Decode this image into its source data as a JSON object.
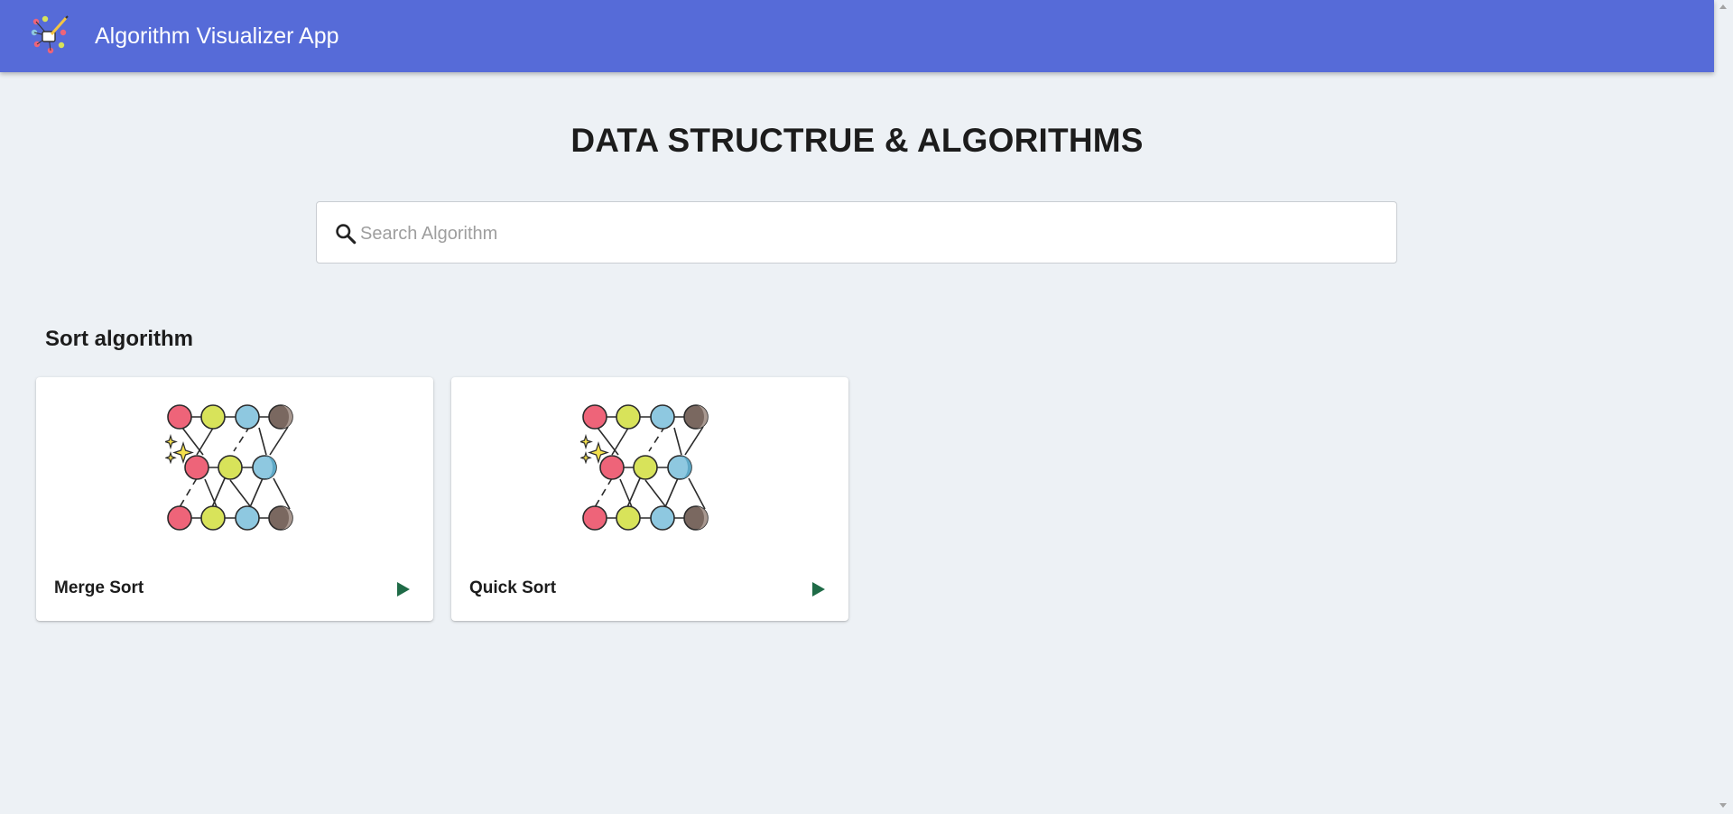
{
  "header": {
    "app_title": "Algorithm Visualizer App",
    "logo_icon": "algorithm-logo-icon",
    "background_color": "#566bd8"
  },
  "main": {
    "page_heading": "DATA STRUCTRUE & ALGORITHMS",
    "search": {
      "placeholder": "Search Algorithm",
      "value": "",
      "icon": "search-icon"
    },
    "sections": [
      {
        "title": "Sort algorithm",
        "cards": [
          {
            "label": "Merge Sort",
            "illustration": "sort-network-illustration",
            "action_icon": "play-icon"
          },
          {
            "label": "Quick Sort",
            "illustration": "sort-network-illustration",
            "action_icon": "play-icon"
          }
        ]
      }
    ]
  },
  "colors": {
    "background": "#edf1f5",
    "play_icon": "#1f6b47",
    "node_red": "#ee6479",
    "node_yellow": "#d8e35a",
    "node_blue": "#8ec8e0",
    "node_brown": "#7a6860"
  }
}
